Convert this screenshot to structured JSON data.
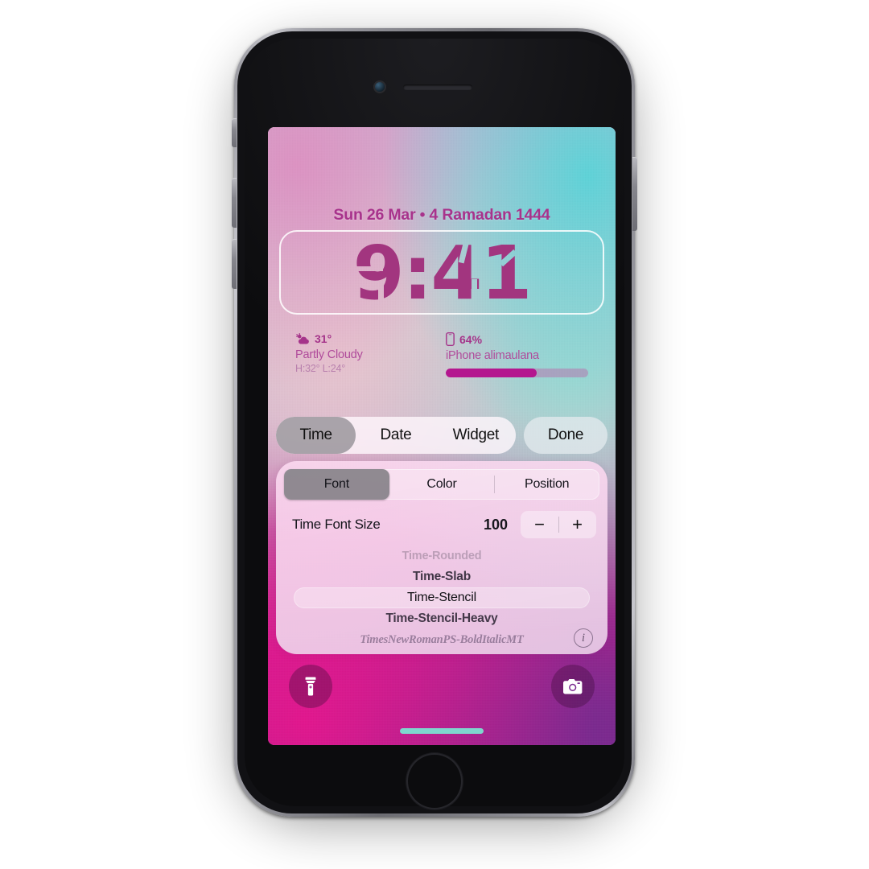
{
  "device": {
    "name": "iphone-8",
    "front_camera": "camera-icon",
    "speaker": "speaker-grille",
    "home_button": "home-button",
    "buttons": [
      "mute-switch",
      "volume-up",
      "volume-down",
      "power"
    ]
  },
  "lockscreen": {
    "date": "Sun 26 Mar • 4 Ramadan 1444",
    "time": "9:41",
    "time_color": "#a2357f",
    "date_color": "#a8338c",
    "weather_widget": {
      "icon": "sun-behind-cloud-icon",
      "temperature": "31°",
      "condition": "Partly Cloudy",
      "high_low": "H:32° L:24°"
    },
    "battery_widget": {
      "icon": "iphone-icon",
      "percent": "64%",
      "percent_value": 64,
      "device_label": "iPhone alimaulana",
      "bar_color": "#b4178f"
    },
    "quick_actions": [
      {
        "name": "flashlight-button",
        "icon": "flashlight-icon"
      },
      {
        "name": "camera-button",
        "icon": "camera-icon"
      }
    ],
    "home_indicator_color": "#7fd6ce"
  },
  "editor": {
    "main_tabs": [
      {
        "label": "Time",
        "selected": true
      },
      {
        "label": "Date",
        "selected": false
      },
      {
        "label": "Widget",
        "selected": false
      }
    ],
    "done_label": "Done",
    "sub_tabs": [
      {
        "label": "Font",
        "selected": true
      },
      {
        "label": "Color",
        "selected": false
      },
      {
        "label": "Position",
        "selected": false
      }
    ],
    "font_size": {
      "label": "Time Font Size",
      "value": "100",
      "decrement": "−",
      "increment": "+"
    },
    "font_list": [
      {
        "name": "Time-Rounded",
        "state": "dim"
      },
      {
        "name": "Time-Slab",
        "state": "normal"
      },
      {
        "name": "Time-Stencil",
        "state": "selected"
      },
      {
        "name": "Time-Stencil-Heavy",
        "state": "normal"
      },
      {
        "name": "TimesNewRomanPS-BoldItalicMT",
        "state": "dim-italic"
      }
    ],
    "info_label": "i"
  }
}
